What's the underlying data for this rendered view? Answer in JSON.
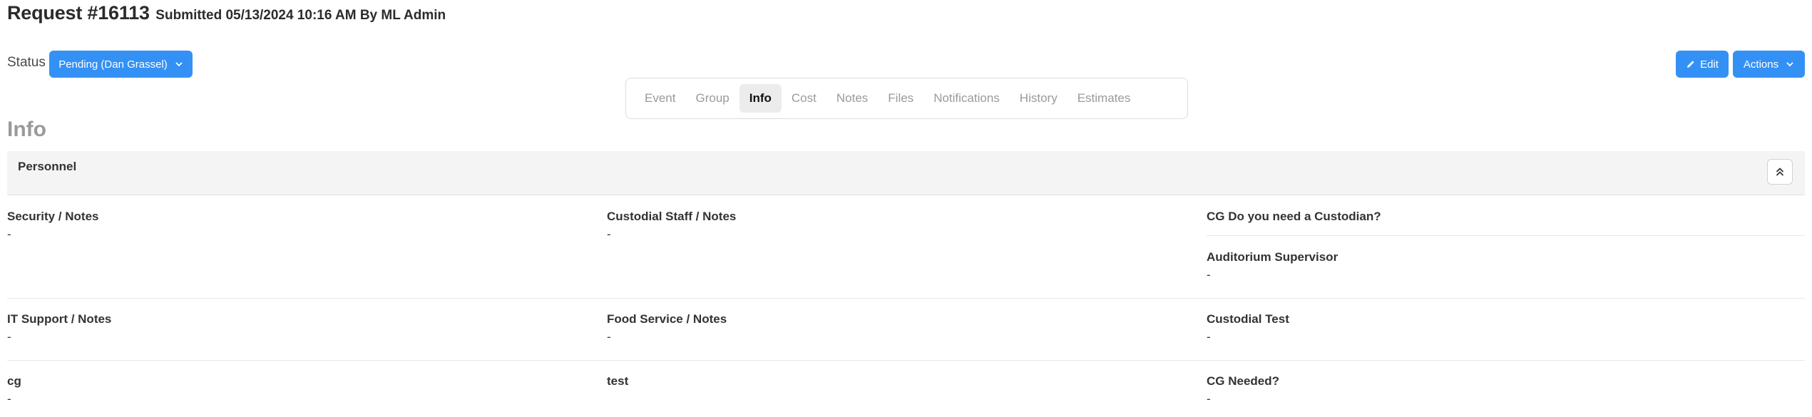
{
  "header": {
    "request_title": "Request #16113",
    "submitted_text": "Submitted 05/13/2024 10:16 AM By ML Admin"
  },
  "status": {
    "label": "Status",
    "value": "Pending (Dan Grassel)"
  },
  "actions": {
    "edit_label": "Edit",
    "actions_label": "Actions"
  },
  "tabs": [
    {
      "label": "Event",
      "active": false
    },
    {
      "label": "Group",
      "active": false
    },
    {
      "label": "Info",
      "active": true
    },
    {
      "label": "Cost",
      "active": false
    },
    {
      "label": "Notes",
      "active": false
    },
    {
      "label": "Files",
      "active": false
    },
    {
      "label": "Notifications",
      "active": false
    },
    {
      "label": "History",
      "active": false
    },
    {
      "label": "Estimates",
      "active": false
    }
  ],
  "section": {
    "title": "Info",
    "panel_title": "Personnel"
  },
  "fields": {
    "security": {
      "label": "Security / Notes",
      "value": "-"
    },
    "custodial_staff": {
      "label": "Custodial Staff / Notes",
      "value": "-"
    },
    "cg_custodian": {
      "label": "CG Do you need a Custodian?",
      "value": ""
    },
    "auditorium_supervisor": {
      "label": "Auditorium Supervisor",
      "value": "-"
    },
    "it_support": {
      "label": "IT Support / Notes",
      "value": "-"
    },
    "food_service": {
      "label": "Food Service / Notes",
      "value": "-"
    },
    "custodial_test": {
      "label": "Custodial Test",
      "value": "-"
    },
    "cg": {
      "label": "cg",
      "value": "-"
    },
    "test": {
      "label": "test",
      "value": ""
    },
    "cg_needed": {
      "label": "CG Needed?",
      "value": "-"
    }
  },
  "colors": {
    "primary": "#3391f5",
    "panel_bg": "#f4f4f4",
    "active_tab_bg": "#ececec"
  },
  "icons": {
    "edit": "pencil-icon",
    "dropdown": "chevron-down-icon",
    "collapse": "double-chevron-up-icon"
  }
}
